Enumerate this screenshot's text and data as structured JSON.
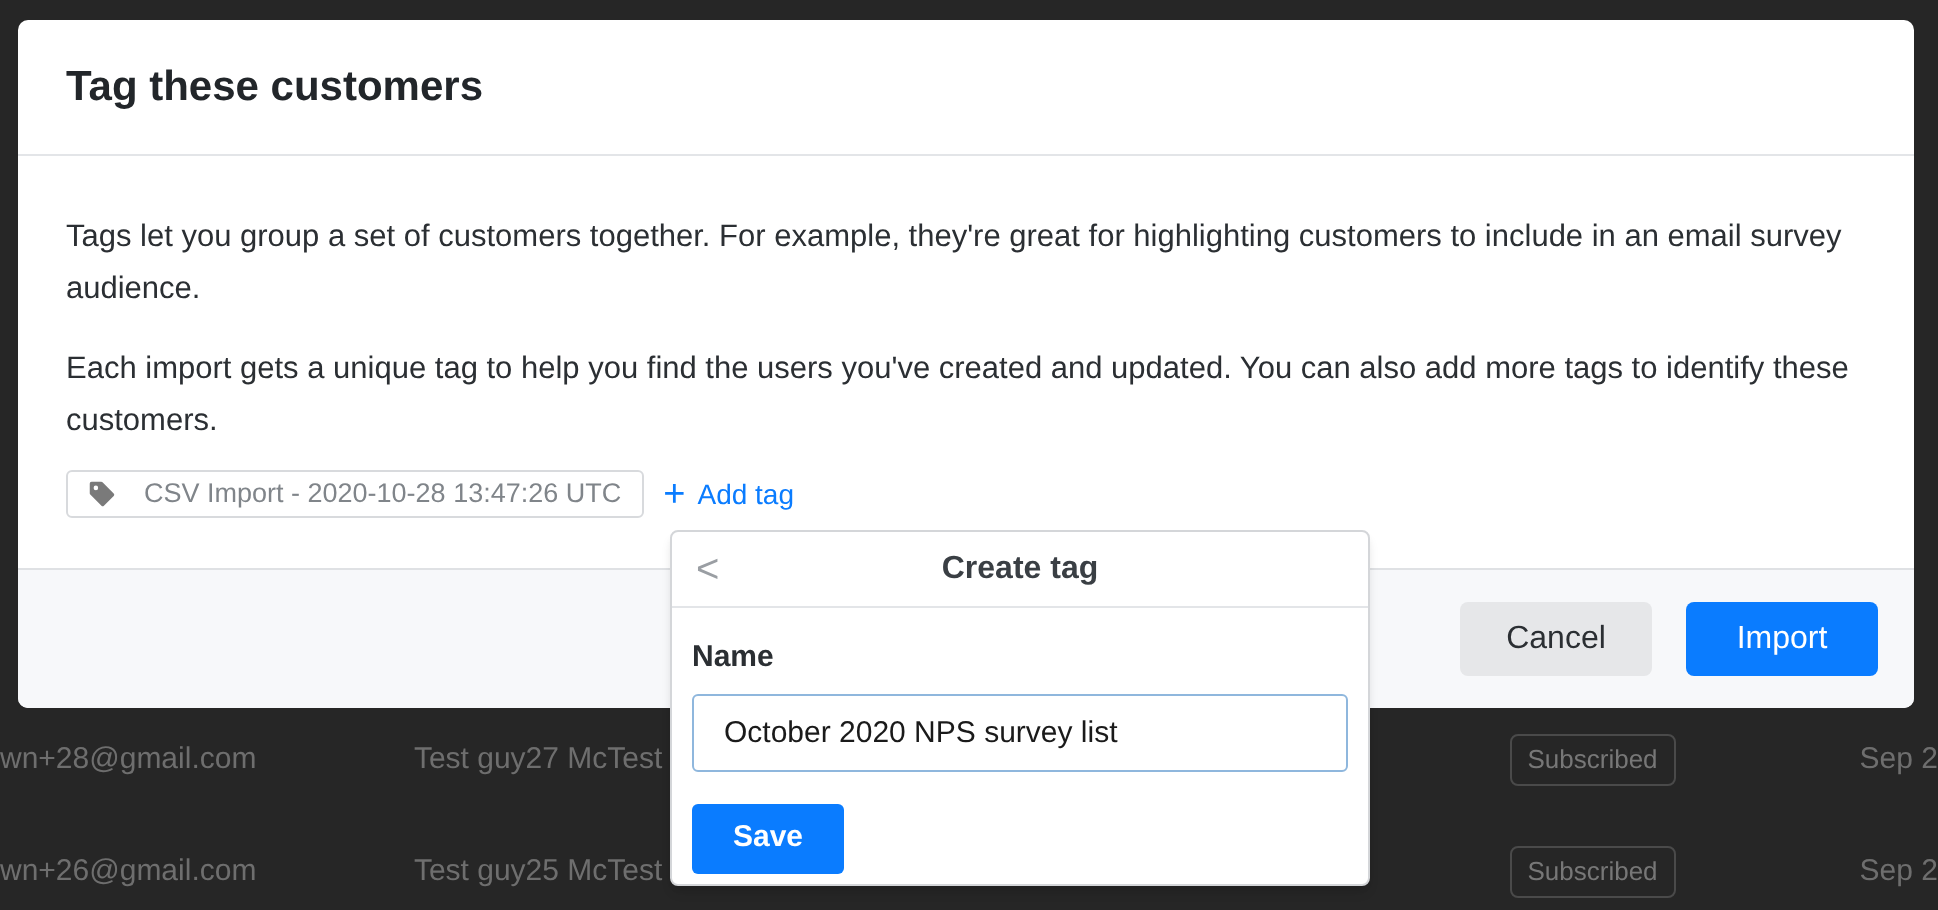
{
  "background_rows": [
    {
      "email": "wn+28@gmail.com",
      "name": "Test guy27 McTest",
      "status": "Subscribed",
      "date": "Sep 2"
    },
    {
      "email": "wn+26@gmail.com",
      "name": "Test guy25 McTest",
      "status": "Subscribed",
      "date": "Sep 2"
    }
  ],
  "dialog": {
    "title": "Tag these customers",
    "paragraphs": [
      "Tags let you group a set of customers together. For example, they're great for highlighting customers to include in an email survey audience.",
      "Each import gets a unique tag to help you find the users you've created and updated. You can also add more tags to identify these customers."
    ],
    "tags": [
      "CSV Import - 2020-10-28 13:47:26 UTC"
    ],
    "add_tag": {
      "icon": "+",
      "label": "Add tag"
    },
    "buttons": [
      {
        "label": "Cancel",
        "kind": "secondary"
      },
      {
        "label": "Import",
        "kind": "primary"
      }
    ]
  },
  "popover": {
    "back": "<",
    "title": "Create tag",
    "field_label": "Name",
    "value": "October 2020 NPS survey list",
    "save": "Save"
  }
}
